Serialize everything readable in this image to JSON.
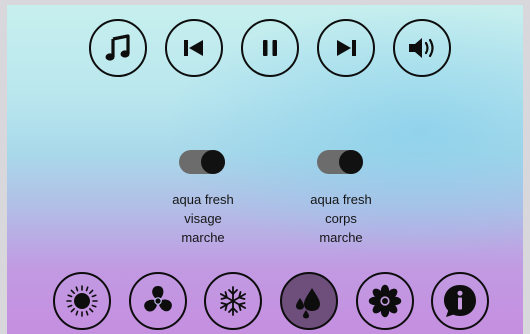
{
  "media_controls": [
    {
      "name": "music-button",
      "icon": "music-note-icon"
    },
    {
      "name": "previous-track-button",
      "icon": "skip-previous-icon"
    },
    {
      "name": "pause-button",
      "icon": "pause-icon"
    },
    {
      "name": "next-track-button",
      "icon": "skip-next-icon"
    },
    {
      "name": "volume-button",
      "icon": "volume-icon"
    }
  ],
  "toggles": [
    {
      "state": "on",
      "lines": [
        "aqua fresh",
        "visage",
        "marche"
      ]
    },
    {
      "state": "on",
      "lines": [
        "aqua fresh",
        "corps",
        "marche"
      ]
    }
  ],
  "mode_buttons": [
    {
      "name": "sun-mode-button",
      "icon": "sun-icon",
      "active": false
    },
    {
      "name": "fan-mode-button",
      "icon": "fan-icon",
      "active": false
    },
    {
      "name": "snowflake-mode-button",
      "icon": "snowflake-icon",
      "active": false
    },
    {
      "name": "water-drops-mode-button",
      "icon": "water-drops-icon",
      "active": true
    },
    {
      "name": "flower-mode-button",
      "icon": "flower-icon",
      "active": false
    },
    {
      "name": "info-button",
      "icon": "info-icon",
      "active": false
    }
  ],
  "colors": {
    "active_button": "#6e4f7c",
    "toggle_track": "#6c6c6c",
    "toggle_knob": "#111111"
  }
}
